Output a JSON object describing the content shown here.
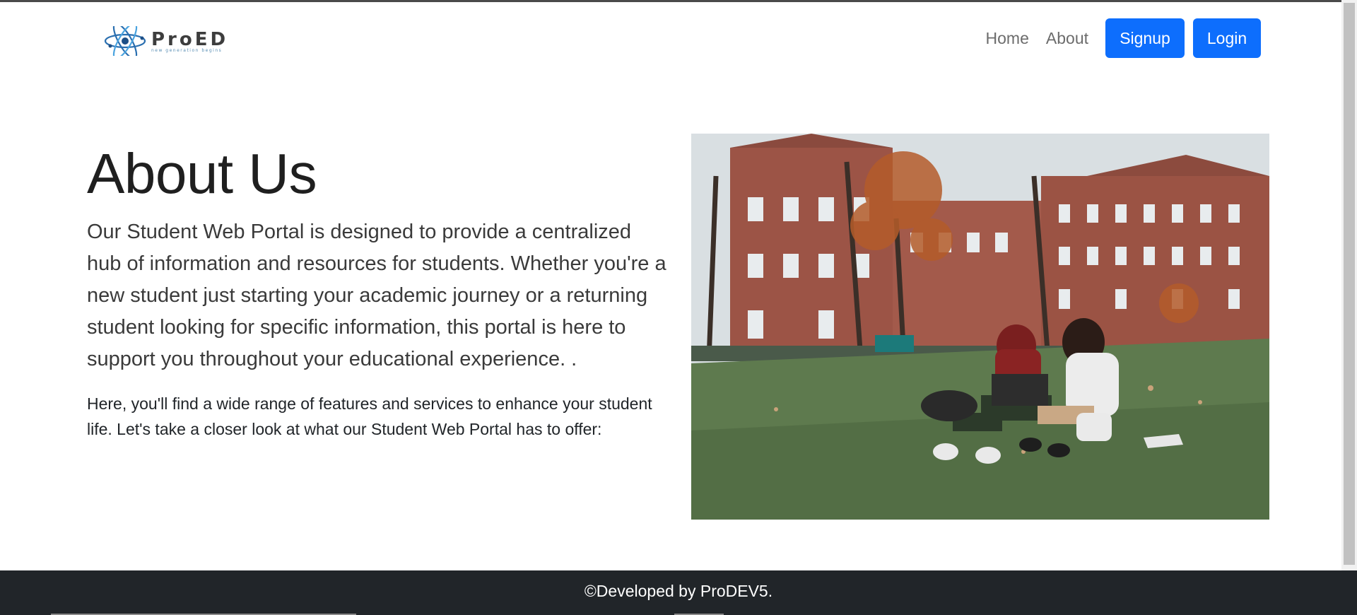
{
  "brand": {
    "name": "ProED",
    "tagline": "new generation begins",
    "logo_icon": "atom-icon"
  },
  "nav": {
    "home": "Home",
    "about": "About",
    "signup": "Signup",
    "login": "Login"
  },
  "main": {
    "title": "About Us",
    "lead": "Our Student Web Portal is designed to provide a centralized hub of information and resources for students. Whether you're a new student just starting your academic journey or a returning student looking for specific information, this portal is here to support you throughout your educational experience. .",
    "body": "Here, you'll find a wide range of features and services to enhance your student life. Let's take a closer look at what our Student Web Portal has to offer:",
    "image_alt": "Two students studying on campus lawn"
  },
  "footer": {
    "text": "©Developed by ProDEV5."
  },
  "colors": {
    "primary": "#0d6efd",
    "footer_bg": "#212529"
  }
}
